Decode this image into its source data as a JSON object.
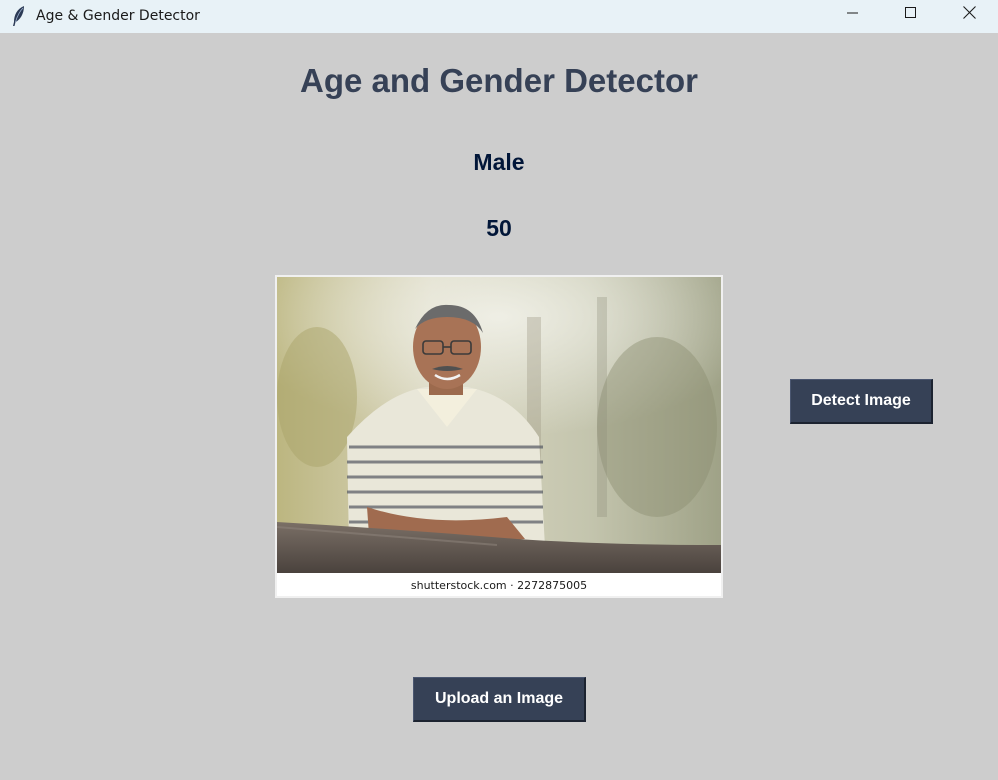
{
  "window": {
    "title": "Age & Gender Detector",
    "app_icon": "feather-icon",
    "controls": [
      "minimize-icon",
      "maximize-icon",
      "close-icon"
    ]
  },
  "main": {
    "heading": "Age and Gender Detector",
    "gender_result": "Male",
    "age_result": "50",
    "image": {
      "watermark": "shutterstock.com · 2272875005"
    },
    "detect_button": "Detect Image",
    "upload_button": "Upload an Image"
  },
  "colors": {
    "background": "#cdcdcd",
    "heading": "#364156",
    "result_text": "#011638",
    "button_bg": "#364156",
    "button_text": "#ffffff"
  }
}
